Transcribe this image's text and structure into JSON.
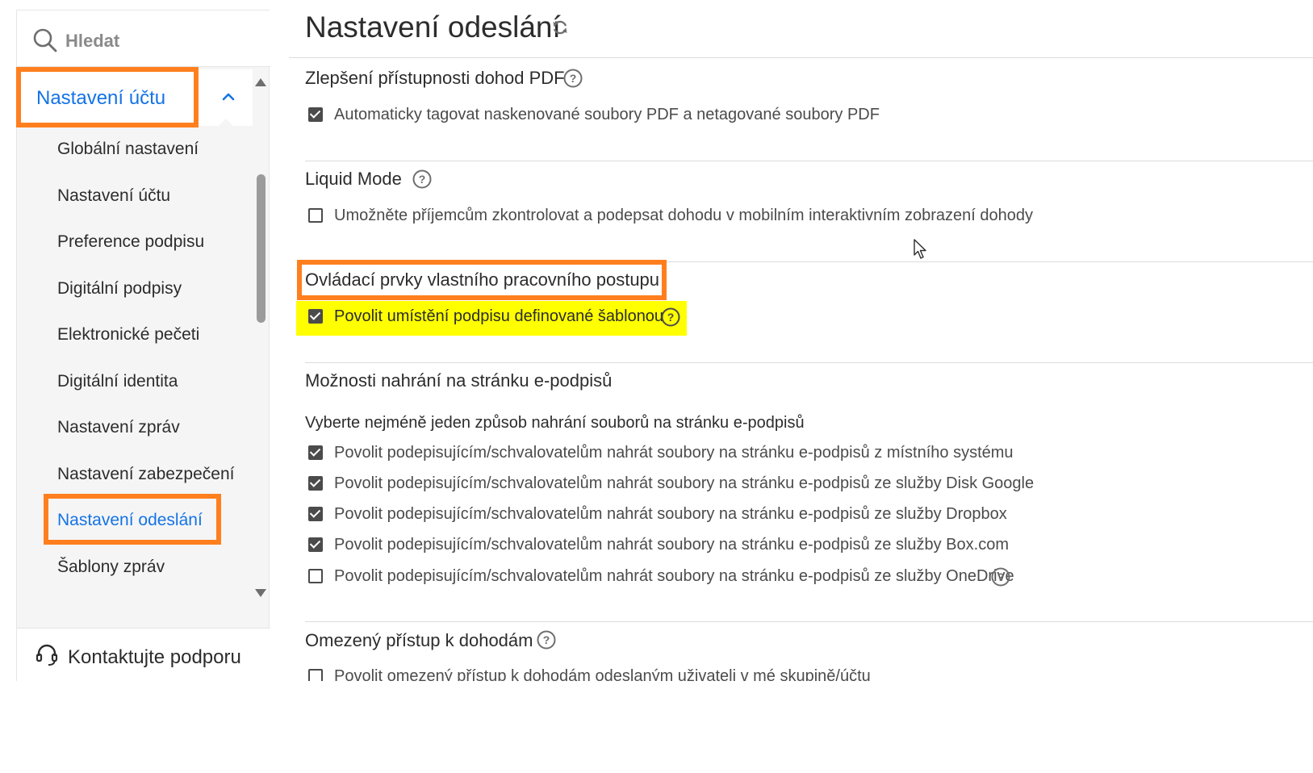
{
  "sidebar": {
    "search_placeholder": "Hledat",
    "account_section": "Nastavení účtu",
    "items": [
      {
        "label": "Globální nastavení"
      },
      {
        "label": "Nastavení účtu"
      },
      {
        "label": "Preference podpisu"
      },
      {
        "label": "Digitální podpisy"
      },
      {
        "label": "Elektronické pečeti"
      },
      {
        "label": "Digitální identita"
      },
      {
        "label": "Nastavení zpráv"
      },
      {
        "label": "Nastavení zabezpečení"
      },
      {
        "label": "Nastavení odeslání",
        "active": true
      },
      {
        "label": "Šablony zpráv"
      }
    ],
    "support_label": "Kontaktujte podporu"
  },
  "main": {
    "title": "Nastavení odeslání",
    "sections": [
      {
        "title": "Zlepšení přístupnosti dohod PDF",
        "has_help": true,
        "options": [
          {
            "label": "Automaticky tagovat naskenované soubory PDF a netagované soubory PDF",
            "checked": true
          }
        ]
      },
      {
        "title": "Liquid Mode",
        "has_help": true,
        "options": [
          {
            "label": "Umožněte příjemcům zkontrolovat a podepsat dohodu v mobilním interaktivním zobrazení dohody",
            "checked": false
          }
        ]
      },
      {
        "title": "Ovládací prvky vlastního pracovního postupu",
        "has_help": false,
        "options": [
          {
            "label": "Povolit umístění podpisu definované šablonou",
            "checked": true,
            "has_help": true
          }
        ]
      },
      {
        "title": "Možnosti nahrání na stránku e-podpisů",
        "has_help": false,
        "description": "Vyberte nejméně jeden způsob nahrání souborů na stránku e-podpisů",
        "options": [
          {
            "label": "Povolit podepisujícím/schvalovatelům nahrát soubory na stránku e-podpisů z místního systému",
            "checked": true
          },
          {
            "label": "Povolit podepisujícím/schvalovatelům nahrát soubory na stránku e-podpisů ze služby Disk Google",
            "checked": true
          },
          {
            "label": "Povolit podepisujícím/schvalovatelům nahrát soubory na stránku e-podpisů ze služby Dropbox",
            "checked": true
          },
          {
            "label": "Povolit podepisujícím/schvalovatelům nahrát soubory na stránku e-podpisů ze služby Box.com",
            "checked": true
          },
          {
            "label": "Povolit podepisujícím/schvalovatelům nahrát soubory na stránku e-podpisů ze služby OneDrive",
            "checked": false,
            "has_help": true
          }
        ]
      },
      {
        "title": "Omezený přístup k dohodám",
        "has_help": true,
        "options": [
          {
            "label": "Povolit omezený přístup k dohodám odeslaným uživateli v mé skupině/účtu",
            "checked": false
          }
        ]
      }
    ]
  },
  "colors": {
    "accent_blue": "#1473e6",
    "highlight_orange": "#ff7f1e",
    "highlight_yellow": "#ffff00",
    "checkbox": "#4b4b4b"
  }
}
